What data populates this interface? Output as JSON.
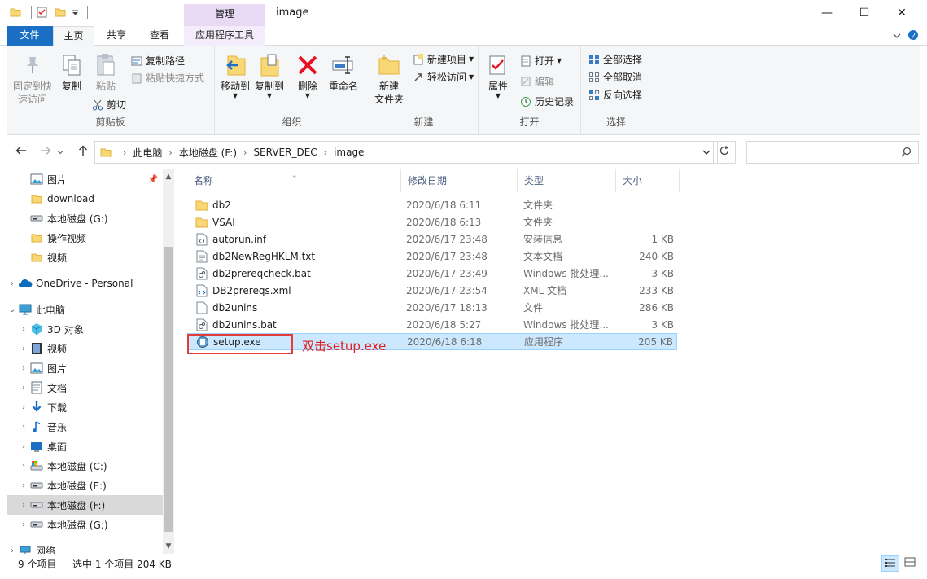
{
  "window": {
    "title": "image",
    "ctx_group": "管理",
    "minimize": "—",
    "maximize": "☐",
    "close": "✕"
  },
  "tabs": {
    "file": "文件",
    "home": "主页",
    "share": "共享",
    "view": "查看",
    "app_tools": "应用程序工具"
  },
  "ribbon": {
    "pin_quick_line1": "固定到快",
    "pin_quick_line2": "速访问",
    "copy": "复制",
    "paste": "粘贴",
    "copy_path": "复制路径",
    "paste_shortcut": "粘贴快捷方式",
    "cut": "剪切",
    "clipboard_group": "剪贴板",
    "move_to": "移动到",
    "copy_to": "复制到",
    "delete": "删除",
    "rename": "重命名",
    "organize_group": "组织",
    "new_folder_line1": "新建",
    "new_folder_line2": "文件夹",
    "new_item": "新建项目",
    "easy_access": "轻松访问",
    "new_group": "新建",
    "properties": "属性",
    "open": "打开",
    "edit": "编辑",
    "history": "历史记录",
    "open_group": "打开",
    "select_all": "全部选择",
    "select_none": "全部取消",
    "invert_selection": "反向选择",
    "select_group": "选择"
  },
  "address": {
    "crumbs": [
      "此电脑",
      "本地磁盘 (F:)",
      "SERVER_DEC",
      "image"
    ],
    "search_placeholder": ""
  },
  "nav": {
    "items": [
      {
        "label": "图片",
        "icon": "pictures-icon"
      },
      {
        "label": "download",
        "icon": "folder-icon"
      },
      {
        "label": "本地磁盘 (G:)",
        "icon": "drive-icon"
      },
      {
        "label": "操作视频",
        "icon": "folder-icon"
      },
      {
        "label": "视频",
        "icon": "folder-icon"
      },
      {
        "label": "OneDrive - Personal",
        "icon": "onedrive-icon"
      },
      {
        "label": "此电脑",
        "icon": "pc-icon"
      },
      {
        "label": "3D 对象",
        "icon": "3d-objects-icon"
      },
      {
        "label": "视频",
        "icon": "videos-icon"
      },
      {
        "label": "图片",
        "icon": "pictures-icon"
      },
      {
        "label": "文档",
        "icon": "documents-icon"
      },
      {
        "label": "下载",
        "icon": "downloads-icon"
      },
      {
        "label": "音乐",
        "icon": "music-icon"
      },
      {
        "label": "桌面",
        "icon": "desktop-icon"
      },
      {
        "label": "本地磁盘 (C:)",
        "icon": "system-drive-icon"
      },
      {
        "label": "本地磁盘 (E:)",
        "icon": "drive-icon"
      },
      {
        "label": "本地磁盘 (F:)",
        "icon": "drive-icon"
      },
      {
        "label": "本地磁盘 (G:)",
        "icon": "drive-icon"
      },
      {
        "label": "网络",
        "icon": "network-icon"
      }
    ]
  },
  "columns": {
    "name": "名称",
    "date": "修改日期",
    "type": "类型",
    "size": "大小"
  },
  "files": [
    {
      "name": "db2",
      "date": "2020/6/18 6:11",
      "type": "文件夹",
      "size": "",
      "icon": "folder-icon"
    },
    {
      "name": "VSAI",
      "date": "2020/6/18 6:13",
      "type": "文件夹",
      "size": "",
      "icon": "folder-icon"
    },
    {
      "name": "autorun.inf",
      "date": "2020/6/17 23:48",
      "type": "安装信息",
      "size": "1 KB",
      "icon": "settings-file-icon"
    },
    {
      "name": "db2NewRegHKLM.txt",
      "date": "2020/6/17 23:48",
      "type": "文本文档",
      "size": "240 KB",
      "icon": "text-file-icon"
    },
    {
      "name": "db2prereqcheck.bat",
      "date": "2020/6/17 23:49",
      "type": "Windows 批处理...",
      "size": "3 KB",
      "icon": "batch-file-icon"
    },
    {
      "name": "DB2prereqs.xml",
      "date": "2020/6/17 23:54",
      "type": "XML 文档",
      "size": "233 KB",
      "icon": "xml-file-icon"
    },
    {
      "name": "db2unins",
      "date": "2020/6/17 18:13",
      "type": "文件",
      "size": "286 KB",
      "icon": "blank-file-icon"
    },
    {
      "name": "db2unins.bat",
      "date": "2020/6/18 5:27",
      "type": "Windows 批处理...",
      "size": "3 KB",
      "icon": "batch-file-icon"
    },
    {
      "name": "setup.exe",
      "date": "2020/6/18 6:18",
      "type": "应用程序",
      "size": "205 KB",
      "icon": "setup-exe-icon"
    }
  ],
  "annotation": "双击setup.exe",
  "status": {
    "count": "9 个项目",
    "selection": "选中 1 个项目  204 KB"
  },
  "colors": {
    "file_tab": "#1a6fc4",
    "ctx_tab": "#e8d9f5",
    "selection": "#cce8ff",
    "annotation": "#e02020"
  }
}
